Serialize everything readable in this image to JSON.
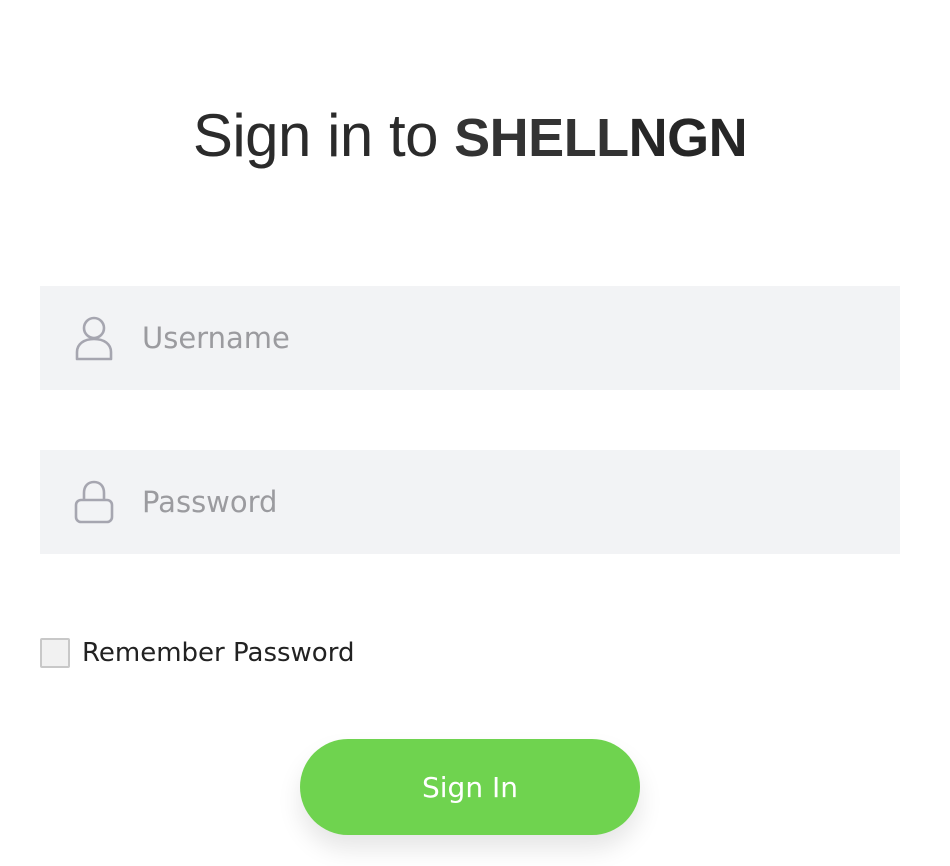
{
  "title": {
    "prefix": "Sign in to ",
    "brand_part1": "SHELL",
    "brand_part2": "NGN"
  },
  "username": {
    "icon": "user-icon",
    "placeholder": "Username",
    "value": ""
  },
  "password": {
    "icon": "lock-icon",
    "placeholder": "Password",
    "value": ""
  },
  "remember": {
    "label": "Remember Password",
    "checked": false
  },
  "signin": {
    "label": "Sign In",
    "color": "#6fd34f"
  },
  "colors": {
    "field_bg": "#f2f3f5",
    "icon": "#a6a6b0"
  }
}
